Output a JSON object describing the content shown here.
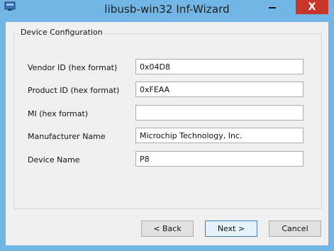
{
  "window": {
    "title": "libusb-win32 Inf-Wizard",
    "close_glyph": "X"
  },
  "group": {
    "title": "Device Configuration"
  },
  "fields": {
    "vendor_id": {
      "label": "Vendor ID (hex format)",
      "value": "0x04D8"
    },
    "product_id": {
      "label": "Product ID (hex format)",
      "value": "0xFEAA"
    },
    "mi": {
      "label": "MI (hex format)",
      "value": ""
    },
    "manufacturer": {
      "label": "Manufacturer Name",
      "value": "Microchip Technology, Inc."
    },
    "device_name": {
      "label": "Device Name",
      "value": "P8"
    }
  },
  "buttons": {
    "back": "< Back",
    "next": "Next >",
    "cancel": "Cancel"
  },
  "icons": {
    "app": "usb-app-icon",
    "minimize": "minimize-icon",
    "close": "close-icon"
  },
  "colors": {
    "titlebar": "#72b6e6",
    "close_button": "#c7352b",
    "client_bg": "#f0f0f0"
  }
}
